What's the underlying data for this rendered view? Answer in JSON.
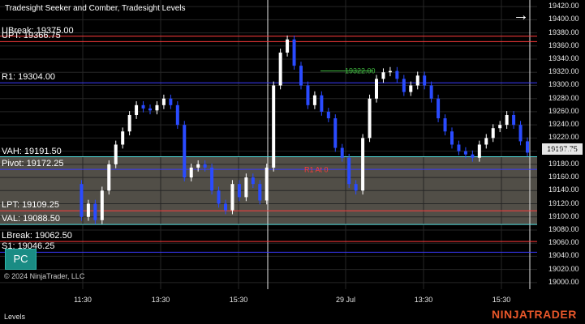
{
  "title": "Tradesight Seeker and Comber, Tradesight Levels",
  "copyright": "© 2024 NinjaTrader, LLC",
  "panel_label": "Levels",
  "brand": "NINJATRADER",
  "pc_button": "PC",
  "arrow_icon": "arrow-right-icon",
  "current_price": "19197.75",
  "levels": [
    {
      "label": "UBreak: 19375.00",
      "price": 19375.0,
      "color": "#ff3b3b"
    },
    {
      "label": "UPT: 19366.75",
      "price": 19366.75,
      "color": "#ff3b3b"
    },
    {
      "label": "R1: 19304.00",
      "price": 19304.0,
      "color": "#3a3aff"
    },
    {
      "label": "VAH: 19191.50",
      "price": 19191.5,
      "color": "#55e0e0"
    },
    {
      "label": "Pivot: 19172.25",
      "price": 19172.25,
      "color": "#3a3aff"
    },
    {
      "label": "LPT: 19109.25",
      "price": 19109.25,
      "color": "#ff3b3b"
    },
    {
      "label": "VAL: 19088.50",
      "price": 19088.5,
      "color": "#55e0e0"
    },
    {
      "label": "LBreak: 19062.50",
      "price": 19062.5,
      "color": "#ff3b3b"
    },
    {
      "label": "S1: 19046.25",
      "price": 19046.25,
      "color": "#3a3aff"
    }
  ],
  "annotations": [
    {
      "text": "19322.00",
      "color": "#3fb93f"
    },
    {
      "text": "R1 At 0",
      "color": "#ff3b3b"
    }
  ],
  "chart_data": {
    "type": "candlestick",
    "y_ticks": [
      19420,
      19400,
      19380,
      19360,
      19340,
      19320,
      19300,
      19280,
      19260,
      19240,
      19220,
      19200,
      19180,
      19160,
      19140,
      19120,
      19100,
      19080,
      19060,
      19040,
      19020,
      19000
    ],
    "x_ticks": [
      "11:30",
      "13:30",
      "15:30",
      "29 Jul",
      "13:30",
      "15:30"
    ],
    "ylim": [
      18990,
      19430
    ],
    "value_area": {
      "high": 19191.5,
      "low": 19088.5
    },
    "series": [
      {
        "name": "price",
        "values": [
          19150,
          19100,
          19120,
          19095,
          19140,
          19180,
          19210,
          19230,
          19255,
          19270,
          19265,
          19262,
          19270,
          19280,
          19270,
          19240,
          19160,
          19175,
          19180,
          19175,
          19140,
          19120,
          19110,
          19150,
          19130,
          19160,
          19150,
          19125,
          19175,
          19300,
          19350,
          19370,
          19330,
          19300,
          19270,
          19285,
          19260,
          19250,
          19205,
          19190,
          19150,
          19140,
          19220,
          19280,
          19310,
          19320,
          19322,
          19310,
          19290,
          19300,
          19315,
          19300,
          19280,
          19250,
          19230,
          19210,
          19200,
          19195,
          19190,
          19210,
          19220,
          19235,
          19240,
          19255,
          19240,
          19215,
          19197.75
        ]
      }
    ]
  }
}
